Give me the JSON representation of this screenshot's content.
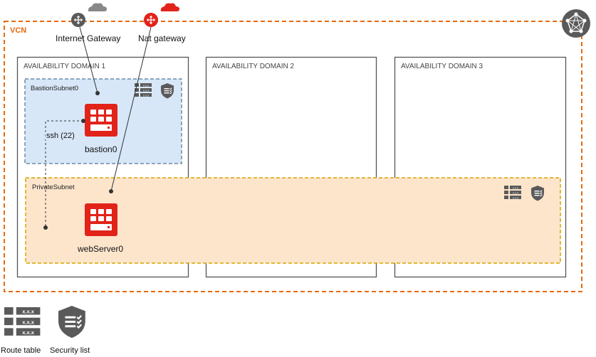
{
  "vcn": {
    "label": "VCN"
  },
  "gateways": {
    "internet": {
      "label": "Internet Gateway"
    },
    "nat": {
      "label": "Nat gateway"
    }
  },
  "availability_domains": [
    {
      "label": "AVAILABILITY DOMAIN 1"
    },
    {
      "label": "AVAILABILITY DOMAIN 2"
    },
    {
      "label": "AVAILABILITY DOMAIN 3"
    }
  ],
  "subnets": {
    "bastion": {
      "label": "BastionSubnet0"
    },
    "private": {
      "label": "PrivateSubnet"
    }
  },
  "instances": {
    "bastion": {
      "label": "bastion0"
    },
    "webserver": {
      "label": "webServer0"
    }
  },
  "connection": {
    "label": "ssh (22)"
  },
  "legend": {
    "route_table": {
      "label": "Route table",
      "text": "x.x.x"
    },
    "security_list": {
      "label": "Security list"
    }
  },
  "colors": {
    "vcn_border": "#e8690c",
    "bastion_fill": "#d7e7f8",
    "bastion_border": "#6f8ba8",
    "private_fill": "#fde5cc",
    "private_border": "#d6a400",
    "instance_red": "#e2231a",
    "icon_gray": "#5a5a5a"
  }
}
